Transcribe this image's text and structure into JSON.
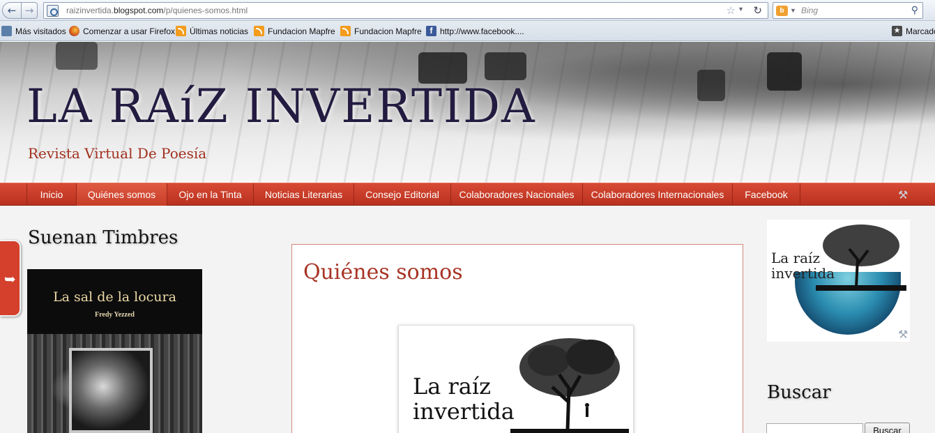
{
  "browser": {
    "url_prefix": "raizinvertida.",
    "url_domain": "blogspot.com",
    "url_path": "/p/quienes-somos.html",
    "search_engine": "Bing",
    "search_placeholder": "Bing",
    "bookmarks": [
      {
        "label": "Más visitados",
        "icon": "most-visited-icon"
      },
      {
        "label": "Comenzar a usar Firefox",
        "icon": "firefox-icon"
      },
      {
        "label": "Últimas noticias",
        "icon": "rss-icon"
      },
      {
        "label": "Fundacion Mapfre",
        "icon": "rss-icon"
      },
      {
        "label": "Fundacion Mapfre",
        "icon": "rss-icon"
      },
      {
        "label": "http://www.facebook....",
        "icon": "facebook-icon"
      },
      {
        "label": "Marcadores",
        "icon": "bookmarks-icon"
      }
    ]
  },
  "header": {
    "title": "LA RAíZ INVERTIDA",
    "description": "Revista Virtual De Poesía"
  },
  "menu": {
    "items": [
      {
        "label": "Inicio",
        "active": false
      },
      {
        "label": "Quiénes somos",
        "active": true
      },
      {
        "label": "Ojo en la Tinta",
        "active": false
      },
      {
        "label": "Noticias Literarias",
        "active": false
      },
      {
        "label": "Consejo Editorial",
        "active": false
      },
      {
        "label": "Colaboradores Nacionales",
        "active": false
      },
      {
        "label": "Colaboradores Internacionales",
        "active": false
      },
      {
        "label": "Facebook",
        "active": false
      }
    ]
  },
  "left_sidebar": {
    "title": "Suenan Timbres",
    "book": {
      "title": "La sal de la locura",
      "author": "Fredy Yezzed"
    }
  },
  "post": {
    "title": "Quiénes somos",
    "logo_line1": "La raíz",
    "logo_line2": "invertida"
  },
  "right_sidebar": {
    "logo_line1": "La raíz",
    "logo_line2": "invertida",
    "search_title": "Buscar",
    "search_button": "Buscar"
  },
  "colors": {
    "menu": "#c73b27",
    "title": "#231b40",
    "accent": "#a83424"
  }
}
